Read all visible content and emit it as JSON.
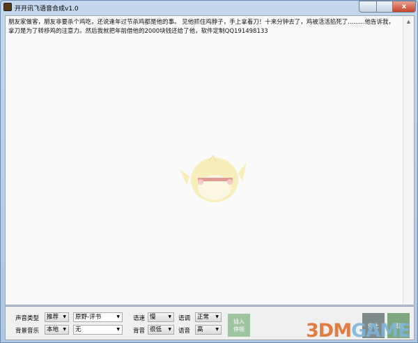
{
  "window": {
    "title": "开开讯飞语音合成v1.0",
    "close": "x"
  },
  "editor": {
    "text": "朋友家做客，朋友非要杀个鸡吃，还说逢年过节杀鸡都是他的事。 见他抓住鸡脖子，手上拿着刀！十来分钟去了，鸡被活活掐死了.........他告诉我，拿刀是为了转移鸡的注意力。然后我就把年前借他的2000块钱还给了他，软件定制QQ191498133",
    "scroll_up": "▲"
  },
  "controls": {
    "voice_type_label": "声音类型",
    "voice_type": "推荐",
    "voice": "原野-评书",
    "speed_label": "语速",
    "speed": "慢",
    "tone_label": "语调",
    "tone": "正常",
    "bgm_label": "背景音乐",
    "bgm_source": "本地",
    "bgm": "无",
    "bg_volume_label": "背音",
    "bg_volume": "很低",
    "volume_label": "语音",
    "volume": "高",
    "insert_pause": "插入\n停顿",
    "stop": "停止",
    "play": "播放",
    "arrow": "▼"
  },
  "watermark": {
    "a": "3DM",
    "b": "GAME"
  }
}
